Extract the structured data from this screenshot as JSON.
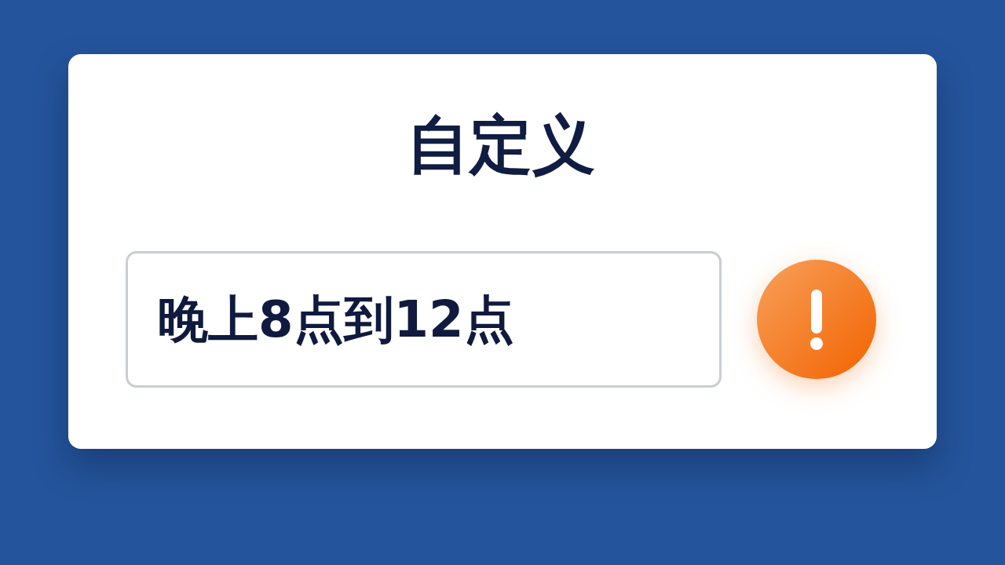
{
  "dialog": {
    "title": "自定义",
    "field": {
      "value": "晚上8点到12点",
      "warning": true
    }
  }
}
